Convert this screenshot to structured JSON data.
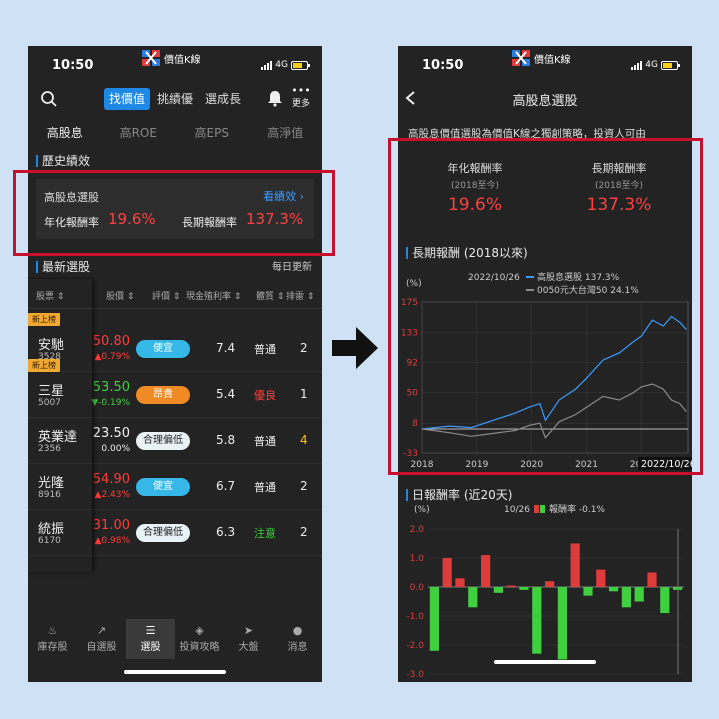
{
  "status": {
    "time": "10:50",
    "network": "4G",
    "app_name": "價值K線"
  },
  "left": {
    "top_tabs": [
      "找價值",
      "挑績優",
      "選成長"
    ],
    "more_label": "更多",
    "sub_tabs": [
      "高股息",
      "高ROE",
      "高EPS",
      "高淨值"
    ],
    "history_section": "歷史績效",
    "history_card": {
      "name": "高股息選股",
      "link": "看績效 ›",
      "annual_label": "年化報酬率",
      "annual_value": "19.6%",
      "long_label": "長期報酬率",
      "long_value": "137.3%"
    },
    "latest_section": "最新選股",
    "daily_update": "每日更新",
    "columns": [
      "股票",
      "股價",
      "評價",
      "現金殖利率",
      "體質",
      "排雷"
    ],
    "rows": [
      {
        "badge": "新上榜",
        "name": "安馳",
        "code": "3528",
        "price": "50.80",
        "change": "▲0.79%",
        "rating": "便宜",
        "yield": "7.4",
        "health": "普通",
        "mine": "2"
      },
      {
        "badge": "新上榜",
        "name": "三星",
        "code": "5007",
        "price": "53.50",
        "change": "▼-0.19%",
        "rating": "昂貴",
        "yield": "5.4",
        "health": "優良",
        "mine": "1"
      },
      {
        "badge": "",
        "name": "英業達",
        "code": "2356",
        "price": "23.50",
        "change": "0.00%",
        "rating": "合理偏低",
        "yield": "5.8",
        "health": "普通",
        "mine": "4"
      },
      {
        "badge": "",
        "name": "光隆",
        "code": "8916",
        "price": "54.90",
        "change": "▲2.43%",
        "rating": "便宜",
        "yield": "6.7",
        "health": "普通",
        "mine": "2"
      },
      {
        "badge": "",
        "name": "統振",
        "code": "6170",
        "price": "31.00",
        "change": "▲0.98%",
        "rating": "合理偏低",
        "yield": "6.3",
        "health": "注意",
        "mine": "2"
      }
    ],
    "nav": [
      "庫存股",
      "自選股",
      "選股",
      "投資攻略",
      "大盤",
      "消息"
    ]
  },
  "right": {
    "title": "高股息選股",
    "intro": "高股息價值選股為價值K線之獨創策略，投資人可由",
    "stat1_label": "年化報酬率",
    "stat1_period": "(2018至今)",
    "stat1_value": "19.6%",
    "stat2_label": "長期報酬率",
    "stat2_period": "(2018至今)",
    "stat2_value": "137.3%",
    "long_section": "長期報酬 (2018以來)",
    "daily_section": "日報酬率 (近20天)"
  },
  "colors": {
    "accent": "#1e88e5",
    "up": "#ff3b3b",
    "down": "#3fcf3f",
    "highlight_border": "#c8102e",
    "new_badge": "#f0a830"
  },
  "chart_data": [
    {
      "type": "line",
      "title": "長期報酬 (2018以來)",
      "unit_label": "(%)",
      "date_label": "2022/10/26",
      "cursor_label": "2022/10/26",
      "x_ticks": [
        "2018",
        "2019",
        "2020",
        "2021",
        "2022"
      ],
      "y_ticks": [
        175,
        133,
        92,
        50,
        8,
        -33
      ],
      "ylim": [
        -33,
        175
      ],
      "xlim": [
        2018.0,
        2022.85
      ],
      "series": [
        {
          "name": "高股息選股",
          "legend": "高股息選股 137.3%",
          "color": "#3b9cff",
          "x": [
            2018.0,
            2018.5,
            2018.9,
            2019.3,
            2019.7,
            2019.95,
            2020.15,
            2020.25,
            2020.5,
            2020.8,
            2021.0,
            2021.3,
            2021.6,
            2021.85,
            2022.0,
            2022.2,
            2022.4,
            2022.55,
            2022.7,
            2022.82
          ],
          "y": [
            0,
            4,
            2,
            12,
            22,
            30,
            35,
            12,
            40,
            55,
            70,
            95,
            105,
            120,
            128,
            150,
            142,
            155,
            147,
            137
          ]
        },
        {
          "name": "0050元大台灣50",
          "legend": "0050元大台灣50 24.1%",
          "color": "#8a8a8a",
          "x": [
            2018.0,
            2018.5,
            2018.9,
            2019.3,
            2019.7,
            2019.95,
            2020.15,
            2020.25,
            2020.5,
            2020.8,
            2021.0,
            2021.3,
            2021.6,
            2021.85,
            2022.0,
            2022.2,
            2022.4,
            2022.55,
            2022.7,
            2022.82
          ],
          "y": [
            0,
            -5,
            -10,
            -6,
            -2,
            5,
            8,
            -12,
            10,
            20,
            30,
            45,
            40,
            50,
            58,
            62,
            55,
            40,
            35,
            24
          ]
        }
      ]
    },
    {
      "type": "bar",
      "title": "日報酬率 (近20天)",
      "unit_label": "(%)",
      "date_label": "10/26",
      "legend": "報酬率 -0.1%",
      "y_ticks": [
        "2.0",
        "1.0",
        "0.0",
        "-1.0",
        "-2.0",
        "-3.0"
      ],
      "ylim": [
        -3.0,
        2.0
      ],
      "values": [
        -2.2,
        1.0,
        0.3,
        -0.7,
        1.1,
        -0.2,
        0.05,
        -0.1,
        -2.3,
        0.2,
        -2.5,
        1.5,
        -0.3,
        0.6,
        -0.15,
        -0.7,
        -0.5,
        0.5,
        -0.9,
        -0.1
      ]
    }
  ]
}
